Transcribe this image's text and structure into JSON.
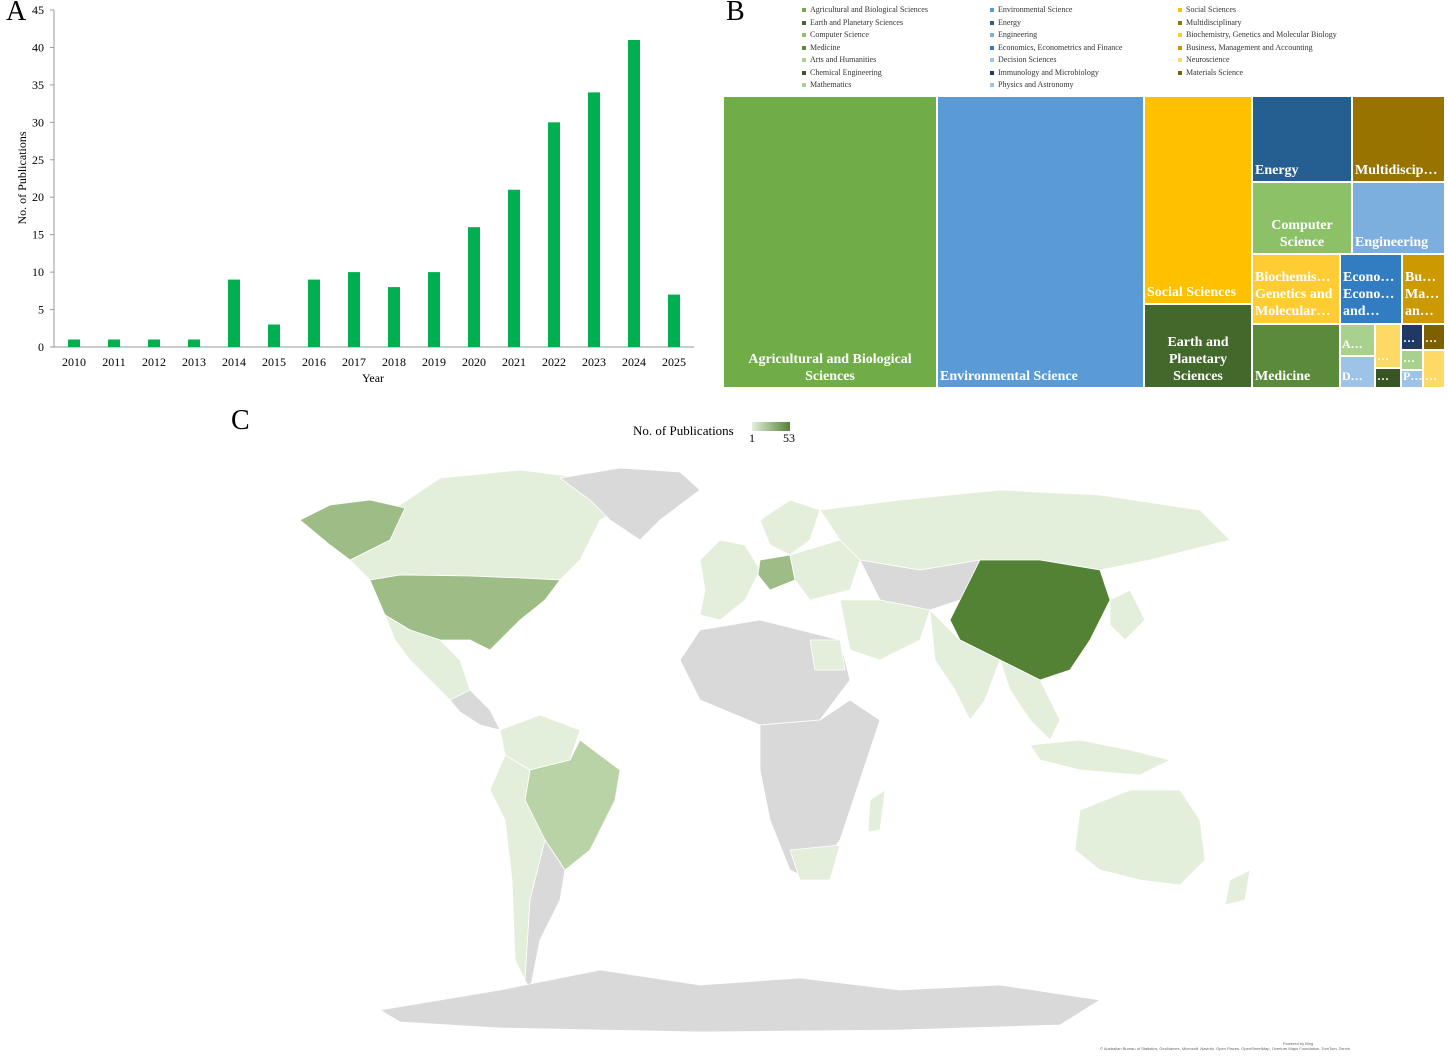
{
  "panels": {
    "a": "A",
    "b": "B",
    "c": "C"
  },
  "chart_data": [
    {
      "type": "bar",
      "categories": [
        "2010",
        "2011",
        "2012",
        "2013",
        "2014",
        "2015",
        "2016",
        "2017",
        "2018",
        "2019",
        "2020",
        "2021",
        "2022",
        "2023",
        "2024",
        "2025"
      ],
      "values": [
        1,
        1,
        1,
        1,
        9,
        3,
        9,
        10,
        8,
        10,
        16,
        21,
        30,
        34,
        41,
        7
      ],
      "xlabel": "Year",
      "ylabel": "No. of Publications",
      "ylim": [
        0,
        45
      ],
      "yticks": [
        0,
        5,
        10,
        15,
        20,
        25,
        30,
        35,
        40,
        45
      ],
      "bar_color": "#00b050",
      "grid": false
    },
    {
      "type": "treemap",
      "legend": [
        {
          "label": "Agricultural and Biological Sciences",
          "color": "#70ad47"
        },
        {
          "label": "Environmental Science",
          "color": "#5b9bd5"
        },
        {
          "label": "Social Sciences",
          "color": "#ffc000"
        },
        {
          "label": "Earth and Planetary Sciences",
          "color": "#43682b"
        },
        {
          "label": "Energy",
          "color": "#255e91"
        },
        {
          "label": "Multidisciplinary",
          "color": "#997300"
        },
        {
          "label": "Computer Science",
          "color": "#8cc168"
        },
        {
          "label": "Engineering",
          "color": "#7cafdd"
        },
        {
          "label": "Biochemistry, Genetics and Molecular Biology",
          "color": "#ffcd33"
        },
        {
          "label": "Medicine",
          "color": "#5a8a3a"
        },
        {
          "label": "Economics, Econometrics and Finance",
          "color": "#327dc2"
        },
        {
          "label": "Business, Management and Accounting",
          "color": "#cc9a00"
        },
        {
          "label": "Arts and Humanities",
          "color": "#a9d18e"
        },
        {
          "label": "Decision Sciences",
          "color": "#9dc3e6"
        },
        {
          "label": "Neuroscience",
          "color": "#ffd966"
        },
        {
          "label": "Chemical Engineering",
          "color": "#375623"
        },
        {
          "label": "Immunology and Microbiology",
          "color": "#1f3864"
        },
        {
          "label": "Materials Science",
          "color": "#7f6000"
        },
        {
          "label": "Mathematics",
          "color": "#a9d18e"
        },
        {
          "label": "Physics and Astronomy",
          "color": "#9dc3e6"
        }
      ],
      "cells": [
        {
          "label": "Agricultural and Biological Sciences",
          "color": "#70ad47"
        },
        {
          "label": "Environmental Science",
          "color": "#5b9bd5"
        },
        {
          "label": "Social Sciences",
          "color": "#ffc000"
        },
        {
          "label": "Earth and Planetary Sciences",
          "color": "#43682b"
        },
        {
          "label": "Energy",
          "color": "#255e91"
        },
        {
          "label": "Multidiscip…",
          "color": "#997300"
        },
        {
          "label": "Computer Science",
          "color": "#8cc168"
        },
        {
          "label": "Engineering",
          "color": "#7cafdd"
        },
        {
          "label": "Biochemis… Genetics and Molecular…",
          "color": "#ffcd33"
        },
        {
          "label": "Econo… Econo… and…",
          "color": "#327dc2"
        },
        {
          "label": "Bu… Ma… an…",
          "color": "#cc9a00"
        },
        {
          "label": "Medicine",
          "color": "#5a8a3a"
        },
        {
          "label": "A…",
          "color": "#a9d18e"
        },
        {
          "label": "D…",
          "color": "#9dc3e6"
        },
        {
          "label": "…",
          "color": "#ffd966"
        },
        {
          "label": "…",
          "color": "#375623"
        },
        {
          "label": "…",
          "color": "#1f3864"
        },
        {
          "label": "…",
          "color": "#7f6000"
        },
        {
          "label": "…",
          "color": "#a9d18e"
        },
        {
          "label": "P…",
          "color": "#9dc3e6"
        },
        {
          "label": "…",
          "color": "#ffd966"
        }
      ]
    },
    {
      "type": "choropleth",
      "legend_title": "No. of Publications",
      "range": [
        1,
        53
      ],
      "range_labels": [
        "1",
        "53"
      ],
      "color_min": "#e3efdb",
      "color_max": "#548235",
      "no_data_color": "#d9d9d9"
    }
  ]
}
